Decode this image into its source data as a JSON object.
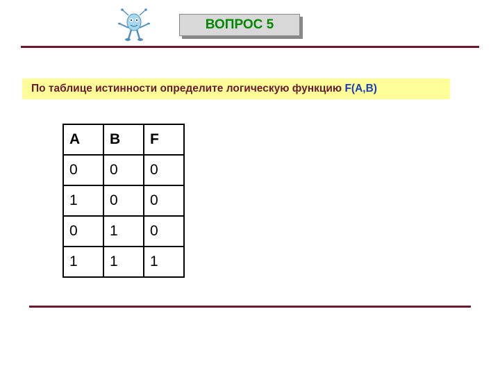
{
  "header": {
    "title": "ВОПРОС 5"
  },
  "instruction": {
    "prefix": "По таблице истинности определите логическую функцию ",
    "fab": "F(A,B)"
  },
  "chart_data": {
    "type": "table",
    "title": "Truth table",
    "columns": [
      "A",
      "B",
      "F"
    ],
    "rows": [
      [
        0,
        0,
        0
      ],
      [
        1,
        0,
        0
      ],
      [
        0,
        1,
        0
      ],
      [
        1,
        1,
        1
      ]
    ]
  },
  "table": {
    "h0": "A",
    "h1": "B",
    "h2": "F",
    "r0c0": "0",
    "r0c1": "0",
    "r0c2": "0",
    "r1c0": "1",
    "r1c1": "0",
    "r1c2": "0",
    "r2c0": "0",
    "r2c1": "1",
    "r2c2": "0",
    "r3c0": "1",
    "r3c1": "1",
    "r3c2": "1"
  }
}
